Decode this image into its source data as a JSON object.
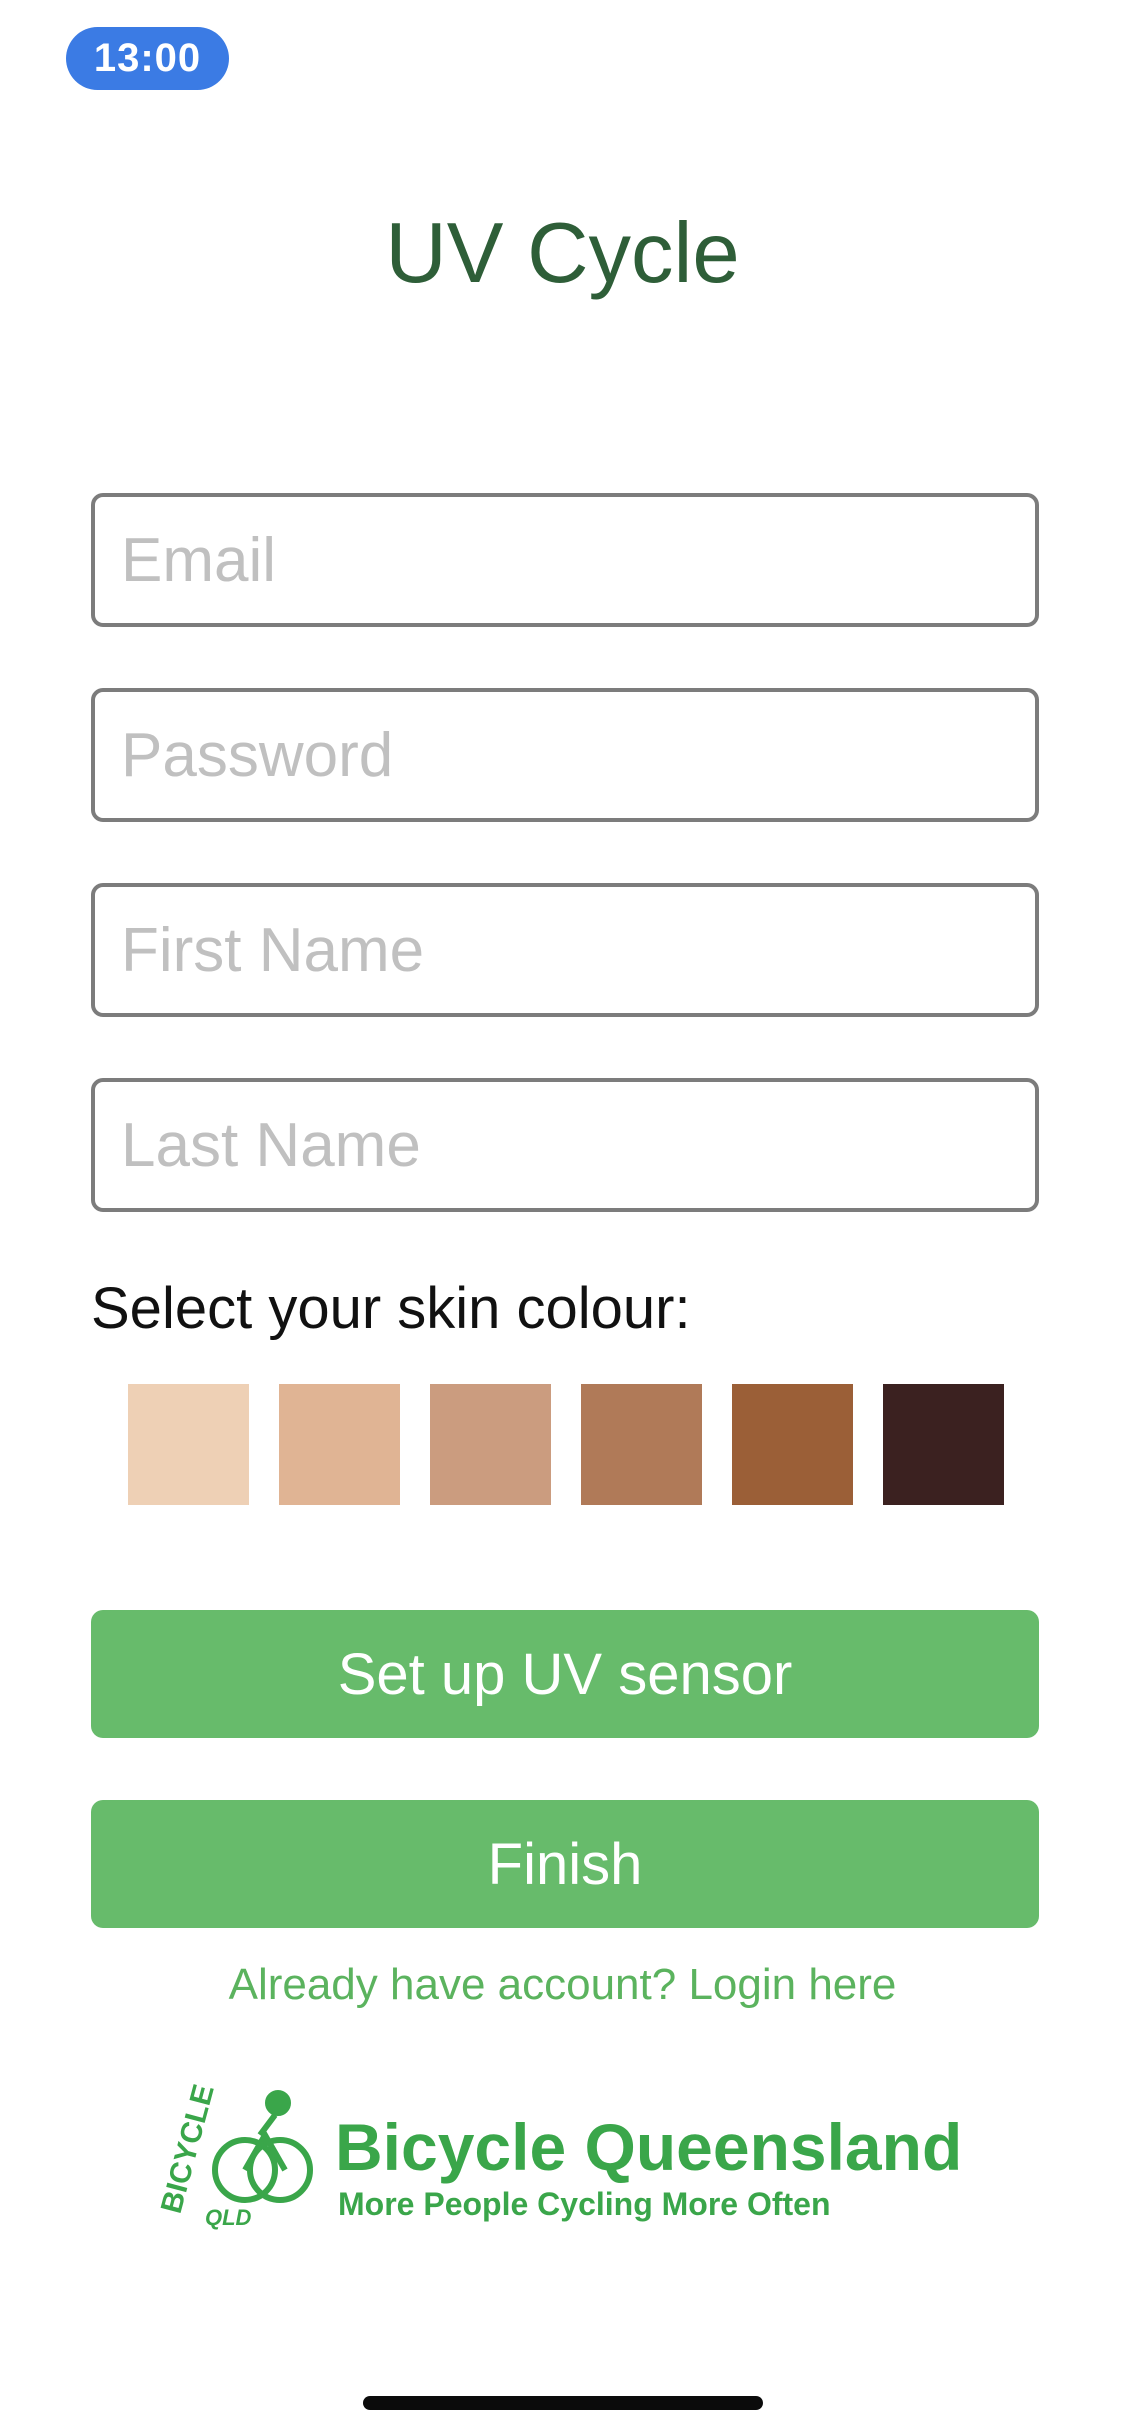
{
  "status": {
    "time": "13:00"
  },
  "app": {
    "title": "UV Cycle"
  },
  "form": {
    "email_placeholder": "Email",
    "email_value": "",
    "password_placeholder": "Password",
    "password_value": "",
    "first_name_placeholder": "First Name",
    "first_name_value": "",
    "last_name_placeholder": "Last Name",
    "last_name_value": "",
    "skin_label": "Select your skin colour:",
    "skin_swatches": [
      "#eed0b5",
      "#e0b494",
      "#cb9c7f",
      "#b07a58",
      "#9b5f37",
      "#3b2120"
    ]
  },
  "buttons": {
    "setup_sensor": "Set up UV sensor",
    "finish": "Finish"
  },
  "login_link": "Already have account? Login here",
  "logo": {
    "name": "Bicycle Queensland",
    "tagline": "More People Cycling More Often",
    "badge_text": "BICYCLE",
    "badge_sub": "QLD",
    "color": "#3aa64a"
  }
}
